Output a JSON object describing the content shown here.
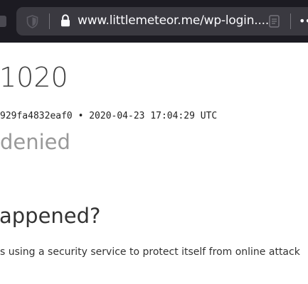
{
  "browser": {
    "address_bar": {
      "url_text": "www.littlemeteor.me/wp-login....",
      "more_glyph": "••"
    },
    "icons": {
      "tracking_protection": "shield-icon",
      "security": "lock-icon",
      "reader_mode": "reader-view-icon",
      "more": "more-icon"
    },
    "colors": {
      "toolbar_bg": "#1c1b22",
      "urlbar_bg": "#3a3940",
      "url_text": "#fbfbfe"
    }
  },
  "error_page": {
    "error_code": "1020",
    "ray_info": "929fa4832eaf0 • 2020-04-23 17:04:29 UTC",
    "status_text": "denied",
    "section_heading": "appened?",
    "description": "s using a security service to protect itself from online attack",
    "colors": {
      "status_text": "#999999",
      "heading": "#333333"
    }
  }
}
